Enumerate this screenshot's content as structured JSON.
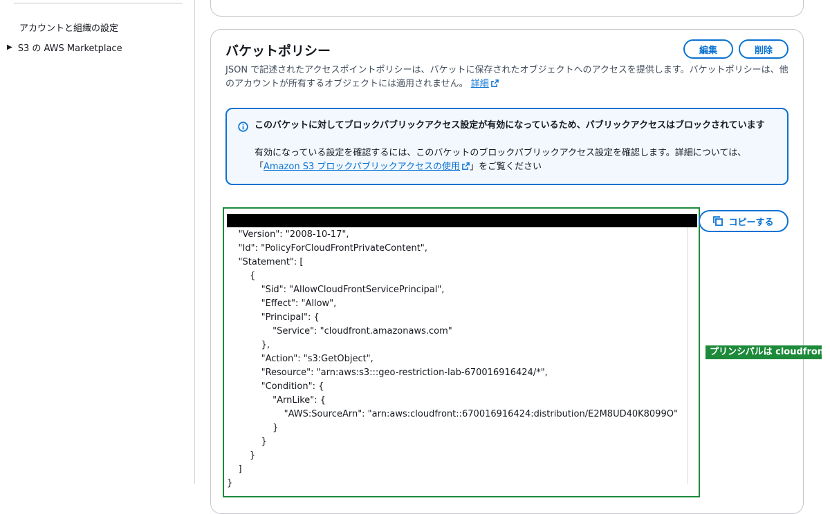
{
  "sidebar": {
    "items": [
      {
        "label": "アカウントと組織の設定"
      },
      {
        "label": "S3 の AWS Marketplace"
      }
    ]
  },
  "policy_card": {
    "title": "バケットポリシー",
    "edit_label": "編集",
    "delete_label": "削除",
    "description": "JSON で記述されたアクセスポイントポリシーは、バケットに保存されたオブジェクトへのアクセスを提供します。バケットポリシーは、他のアカウントが所有するオブジェクトには適用されません。",
    "details_link": "詳細"
  },
  "alert": {
    "title": "このバケットに対してブロックパブリックアクセス設定が有効になっているため、パブリックアクセスはブロックされています",
    "body_prefix": "有効になっている設定を確認するには、このバケットのブロックパブリックアクセス設定を確認します。詳細については、「",
    "body_link": "Amazon S3 ブロックパブリックアクセスの使用",
    "body_suffix": "」をご覧ください"
  },
  "code": {
    "copy_label": "コピーする",
    "lines": [
      "    \"Version\": \"2008-10-17\",",
      "    \"Id\": \"PolicyForCloudFrontPrivateContent\",",
      "    \"Statement\": [",
      "        {",
      "            \"Sid\": \"AllowCloudFrontServicePrincipal\",",
      "            \"Effect\": \"Allow\",",
      "            \"Principal\": {",
      "                \"Service\": \"cloudfront.amazonaws.com\"",
      "            },",
      "            \"Action\": \"s3:GetObject\",",
      "            \"Resource\": \"arn:aws:s3:::geo-restriction-lab-670016916424/*\",",
      "            \"Condition\": {",
      "                \"ArnLike\": {",
      "                    \"AWS:SourceArn\": \"arn:aws:cloudfront::670016916424:distribution/E2M8UD40K8099O\"",
      "                }",
      "            }",
      "        }",
      "    ]",
      "}"
    ]
  },
  "annotation": {
    "label": "プリンシパルは cloudfront"
  },
  "colors": {
    "accent": "#0972d3",
    "annotation_green": "#1d8a3a",
    "alert_bg": "#f2f8fd"
  }
}
